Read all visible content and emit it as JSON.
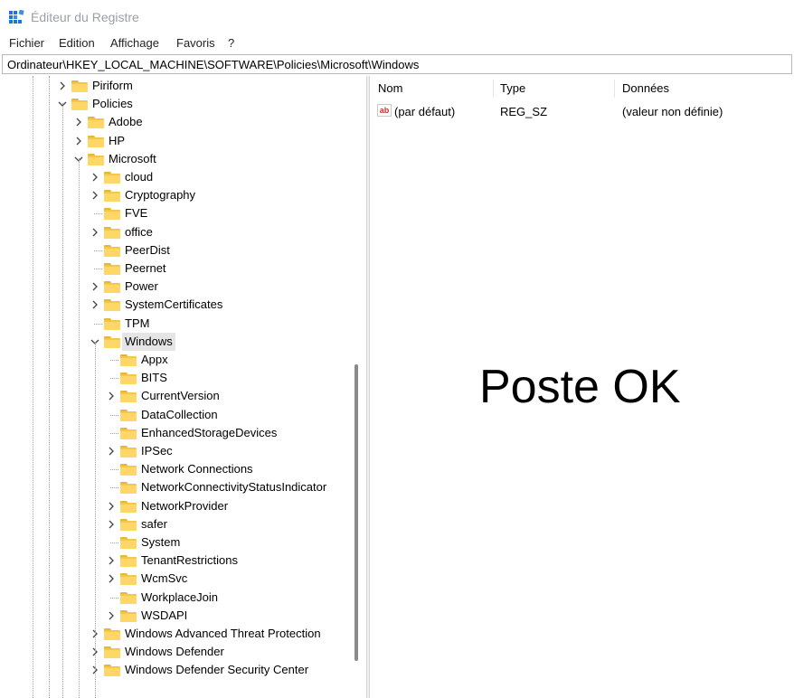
{
  "window": {
    "title": "Éditeur du Registre",
    "app_icon": "regedit-icon"
  },
  "menu": [
    "Fichier",
    "Edition",
    "Affichage",
    "Favoris",
    "?"
  ],
  "address": {
    "path": "Ordinateur\\HKEY_LOCAL_MACHINE\\SOFTWARE\\Policies\\Microsoft\\Windows"
  },
  "tree": [
    {
      "label": "Piriform",
      "chevron": ">"
    },
    {
      "label": "Policies",
      "chevron": "v"
    },
    {
      "label": "Adobe",
      "chevron": ">"
    },
    {
      "label": "HP",
      "chevron": ">"
    },
    {
      "label": "Microsoft",
      "chevron": "v"
    },
    {
      "label": "cloud",
      "chevron": ">"
    },
    {
      "label": "Cryptography",
      "chevron": ">"
    },
    {
      "label": "FVE",
      "chevron": ""
    },
    {
      "label": "office",
      "chevron": ">"
    },
    {
      "label": "PeerDist",
      "chevron": ""
    },
    {
      "label": "Peernet",
      "chevron": ""
    },
    {
      "label": "Power",
      "chevron": ">"
    },
    {
      "label": "SystemCertificates",
      "chevron": ">"
    },
    {
      "label": "TPM",
      "chevron": ""
    },
    {
      "label": "Windows",
      "chevron": "v",
      "selected": true
    },
    {
      "label": "Appx",
      "chevron": ""
    },
    {
      "label": "BITS",
      "chevron": ""
    },
    {
      "label": "CurrentVersion",
      "chevron": ">"
    },
    {
      "label": "DataCollection",
      "chevron": ""
    },
    {
      "label": "EnhancedStorageDevices",
      "chevron": ""
    },
    {
      "label": "IPSec",
      "chevron": ">"
    },
    {
      "label": "Network Connections",
      "chevron": ""
    },
    {
      "label": "NetworkConnectivityStatusIndicator",
      "chevron": ""
    },
    {
      "label": "NetworkProvider",
      "chevron": ">"
    },
    {
      "label": "safer",
      "chevron": ">"
    },
    {
      "label": "System",
      "chevron": ""
    },
    {
      "label": "TenantRestrictions",
      "chevron": ">"
    },
    {
      "label": "WcmSvc",
      "chevron": ">"
    },
    {
      "label": "WorkplaceJoin",
      "chevron": ""
    },
    {
      "label": "WSDAPI",
      "chevron": ">"
    },
    {
      "label": "Windows Advanced Threat Protection",
      "chevron": ">"
    },
    {
      "label": "Windows Defender",
      "chevron": ">"
    },
    {
      "label": "Windows Defender Security Center",
      "chevron": ">"
    }
  ],
  "list": {
    "columns": [
      "Nom",
      "Type",
      "Données"
    ],
    "rows": [
      {
        "name": "(par défaut)",
        "type": "REG_SZ",
        "data": "(valeur non définie)",
        "icon": "string-value-icon",
        "icon_text": "ab"
      }
    ]
  },
  "annotation": {
    "text": "Poste OK"
  },
  "colors": {
    "folder": "#f5c649",
    "selection": "#e5e5e5",
    "accent": "#0067c0"
  }
}
